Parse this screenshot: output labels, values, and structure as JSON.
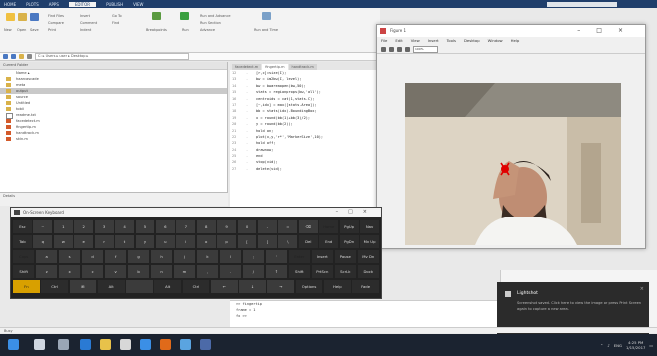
{
  "titlebar": {
    "tabs": [
      "HOME",
      "PLOTS",
      "APPS",
      "EDITOR",
      "PUBLISH",
      "VIEW"
    ],
    "active_tab": "EDITOR"
  },
  "toolstrip": {
    "buttons": [
      "New",
      "Open",
      "Save",
      "Find Files",
      "Compare",
      "Print",
      "Insert",
      "Comment",
      "Indent",
      "Go To",
      "Find",
      "Breakpoints",
      "Run",
      "Run and Advance",
      "Run Section",
      "Advance",
      "Run and Time"
    ]
  },
  "address": {
    "path": "C: ▸ Users ▸ user ▸ Desktop ▸"
  },
  "current_folder": {
    "header": "Current Folder",
    "items": [
      "Name ▴",
      "haarcascade",
      "meta",
      "output",
      "source",
      "Untitled",
      "tobii",
      "readme.txt",
      "facedetect.m",
      "fingertip.m",
      "handtrack.m",
      "skin.m"
    ],
    "selected_index": 3,
    "details_label": "Details"
  },
  "editor": {
    "tabs": [
      "facedetect.m",
      "fingertip.m",
      "handtrack.m"
    ],
    "active_tab": 1,
    "lines": [
      {
        "n": "12",
        "code": "[r,c]=size(I);"
      },
      {
        "n": "13",
        "code": "bw = im2bw(I, level);"
      },
      {
        "n": "14",
        "code": "bw = bwareaopen(bw,50);"
      },
      {
        "n": "15",
        "code": "stats = regionprops(bw,'all');"
      },
      {
        "n": "16",
        "code": "centroids = cat(1,stats.C);"
      },
      {
        "n": "17",
        "code": "[~,idx] = max([stats.Area]);"
      },
      {
        "n": "18",
        "code": "bb = stats(idx).BoundingBox;"
      },
      {
        "n": "19",
        "code": "x = round(bb(1)+bb(3)/2);"
      },
      {
        "n": "20",
        "code": "y = round(bb(2));"
      },
      {
        "n": "21",
        "code": "hold on;"
      },
      {
        "n": "22",
        "code": "plot(x,y,'r*','MarkerSize',10);"
      },
      {
        "n": "23",
        "code": "hold off;"
      },
      {
        "n": "24",
        "code": "drawnow;"
      },
      {
        "n": "25",
        "code": "end"
      },
      {
        "n": "26",
        "code": "stop(vid);"
      },
      {
        "n": "27",
        "code": "delete(vid);"
      }
    ]
  },
  "keyboard": {
    "title": "On-Screen Keyboard",
    "rows": [
      [
        "Esc",
        "~",
        "1",
        "2",
        "3",
        "4",
        "5",
        "6",
        "7",
        "8",
        "9",
        "0",
        "-",
        "=",
        "⌫",
        "Home",
        "PgUp",
        "Nav"
      ],
      [
        "Tab",
        "q",
        "w",
        "e",
        "r",
        "t",
        "y",
        "u",
        "i",
        "o",
        "p",
        "[",
        "]",
        "\\",
        "Del",
        "End",
        "PgDn",
        "Mv Up"
      ],
      [
        "Caps",
        "a",
        "s",
        "d",
        "f",
        "g",
        "h",
        "j",
        "k",
        "l",
        ";",
        "'",
        "Enter",
        "Insert",
        "Pause",
        "Mv Dn"
      ],
      [
        "Shift",
        "z",
        "x",
        "c",
        "v",
        "b",
        "n",
        "m",
        ",",
        ".",
        "/",
        "↑",
        "Shift",
        "PrtScn",
        "ScrLk",
        "Dock"
      ],
      [
        "Fn",
        "Ctrl",
        "⊞",
        "Alt",
        "",
        "Alt",
        "Ctrl",
        "←",
        "↓",
        "→",
        "Options",
        "Help",
        "Fade"
      ]
    ]
  },
  "figure": {
    "title": "Figure 1",
    "menu": [
      "File",
      "Edit",
      "View",
      "Insert",
      "Tools",
      "Desktop",
      "Window",
      "Help"
    ],
    "zoom_field": "100%"
  },
  "command_window": {
    "lines": [
      ">> fingertip",
      "  frame = 1",
      "fx >>"
    ]
  },
  "status": {
    "text": "Busy"
  },
  "notification": {
    "title": "Lightshot",
    "body": "Screenshot saved. Click here to view the image or press Print Screen again to capture a new area."
  },
  "taskbar": {
    "time": "4:25 PM",
    "date": "1/15/2017",
    "lang": "ENG"
  },
  "colors": {
    "matlab_header": "#1f3e6b",
    "keyboard_bg": "#222222",
    "key_highlight": "#d8a000",
    "fingertip_marker": "#e00000",
    "taskbar": "#1b2330"
  }
}
